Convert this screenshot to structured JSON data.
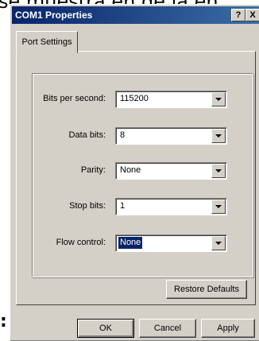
{
  "page": {
    "background_text": "se muestra en de la en",
    "bottom_glyph": ":"
  },
  "window": {
    "title": "COM1 Properties",
    "help_button": "?",
    "close_button": "X"
  },
  "tabs": [
    {
      "label": "Port Settings",
      "active": true
    }
  ],
  "settings": [
    {
      "label": "Bits per second:",
      "value": "115200"
    },
    {
      "label": "Data bits:",
      "value": "8"
    },
    {
      "label": "Parity:",
      "value": "None"
    },
    {
      "label": "Stop bits:",
      "value": "1"
    },
    {
      "label": "Flow control:",
      "value": "None",
      "selected": true
    }
  ],
  "buttons": {
    "restore_defaults": "Restore Defaults",
    "ok": "OK",
    "cancel": "Cancel",
    "apply": "Apply"
  },
  "colors": {
    "face": "#d4d0c8",
    "titlebar": "#0a246a",
    "selection": "#0a246a"
  }
}
